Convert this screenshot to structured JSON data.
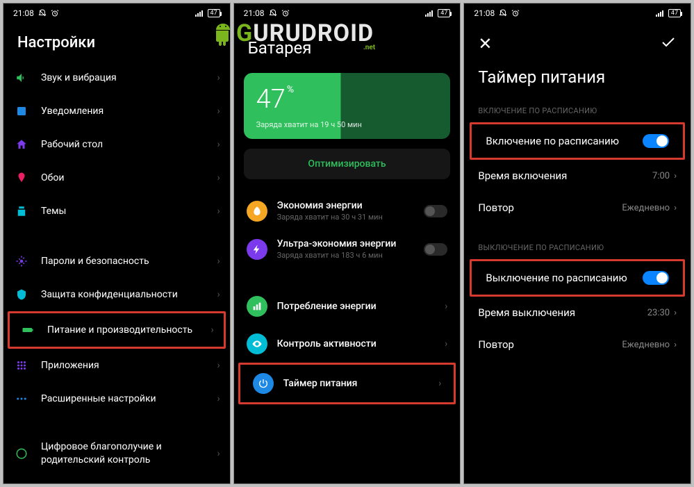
{
  "status": {
    "time": "21:08",
    "battery": "47"
  },
  "watermark": {
    "text_g": "G",
    "text_rest": "URUDROID",
    "suffix": ".net"
  },
  "screen1": {
    "title": "Настройки",
    "items": [
      {
        "label": "Звук и вибрация",
        "icon": "sound",
        "color": "#2fbf5c"
      },
      {
        "label": "Уведомления",
        "icon": "notif",
        "color": "#1e88e5"
      },
      {
        "label": "Рабочий стол",
        "icon": "home",
        "color": "#7c3aed"
      },
      {
        "label": "Обои",
        "icon": "wallpaper",
        "color": "#e91e63"
      },
      {
        "label": "Темы",
        "icon": "themes",
        "color": "#00bcd4"
      }
    ],
    "items2": [
      {
        "label": "Пароли и безопасность",
        "icon": "security",
        "color": "#7c3aed"
      },
      {
        "label": "Защита конфиденциальности",
        "icon": "privacy",
        "color": "#00bcd4"
      },
      {
        "label": "Питание и производительность",
        "icon": "battery",
        "color": "#2fbf5c",
        "highlight": true
      },
      {
        "label": "Приложения",
        "icon": "apps",
        "color": "#7c3aed"
      },
      {
        "label": "Расширенные настройки",
        "icon": "more",
        "color": "#1e88e5"
      }
    ],
    "items3": [
      {
        "label": "Цифровое благополучие и родительский контроль",
        "icon": "wellbeing",
        "color": "#2fbf5c"
      }
    ]
  },
  "screen2": {
    "title": "Батарея",
    "battery_pct": "47",
    "battery_pct_sign": "%",
    "battery_sub": "Заряда хватит на 19 ч 50 мин",
    "optimize": "Оптимизировать",
    "saver": [
      {
        "title": "Экономия энергии",
        "sub": "Заряда хватит на 30 ч 31 мин",
        "color": "#f5a623"
      },
      {
        "title": "Ультра-экономия энергии",
        "sub": "Заряда хватит на 183 ч 6 мин",
        "color": "#7c3aed"
      }
    ],
    "links": [
      {
        "title": "Потребление энергии",
        "color": "#2fbf5c"
      },
      {
        "title": "Контроль активности",
        "color": "#00bcd4"
      },
      {
        "title": "Таймер питания",
        "color": "#1e88e5",
        "highlight": true
      }
    ]
  },
  "screen3": {
    "title": "Таймер питания",
    "sec_on": "ВКЛЮЧЕНИЕ ПО РАСПИСАНИЮ",
    "on_toggle": "Включение по расписанию",
    "on_time_label": "Время включения",
    "on_time_val": "7:00",
    "on_repeat_label": "Повтор",
    "on_repeat_val": "Ежедневно",
    "sec_off": "ВЫКЛЮЧЕНИЕ ПО РАСПИСАНИЮ",
    "off_toggle": "Выключение по расписанию",
    "off_time_label": "Время выключения",
    "off_time_val": "23:30",
    "off_repeat_label": "Повтор",
    "off_repeat_val": "Ежедневно"
  }
}
